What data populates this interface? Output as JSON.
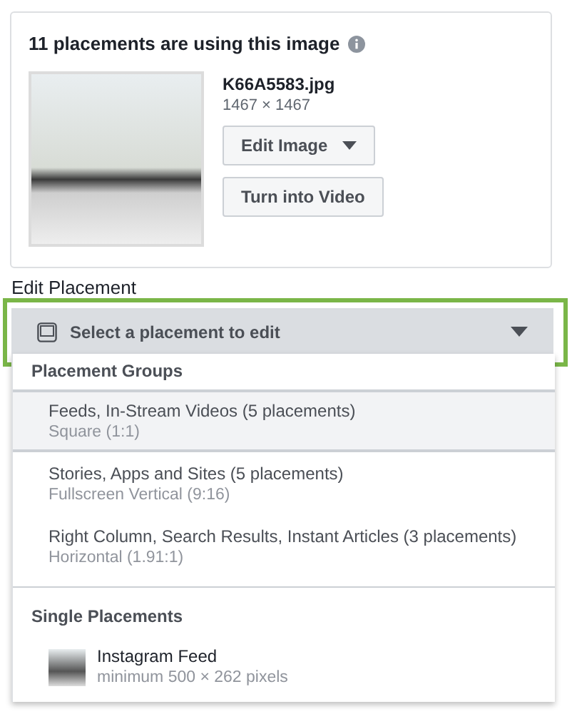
{
  "card": {
    "title": "11 placements are using this image",
    "file_name": "K66A5583.jpg",
    "dimensions": "1467 × 1467",
    "buttons": [
      {
        "label": "Edit Image",
        "kind": "dropdown"
      },
      {
        "label": "Turn into Video",
        "kind": "plain"
      }
    ]
  },
  "edit_placement": {
    "label": "Edit Placement",
    "select": {
      "value": "Select a placement to edit",
      "highlighted": true
    }
  },
  "menu": {
    "sections": [
      {
        "heading": "Placement Groups",
        "items": [
          {
            "title": "Feeds, In-Stream Videos (5 placements)",
            "subtitle": "Square (1:1)",
            "selected": true,
            "thumbnail": false
          },
          {
            "title": "Stories, Apps and Sites (5 placements)",
            "subtitle": "Fullscreen Vertical (9:16)",
            "selected": false,
            "thumbnail": false
          },
          {
            "title": "Right Column, Search Results, Instant Articles (3 placements)",
            "subtitle": "Horizontal (1.91:1)",
            "selected": false,
            "thumbnail": false
          }
        ]
      },
      {
        "heading": "Single Placements",
        "items": [
          {
            "title": "Instagram Feed",
            "subtitle": "minimum 500 × 262 pixels",
            "selected": false,
            "thumbnail": true
          }
        ]
      }
    ]
  }
}
